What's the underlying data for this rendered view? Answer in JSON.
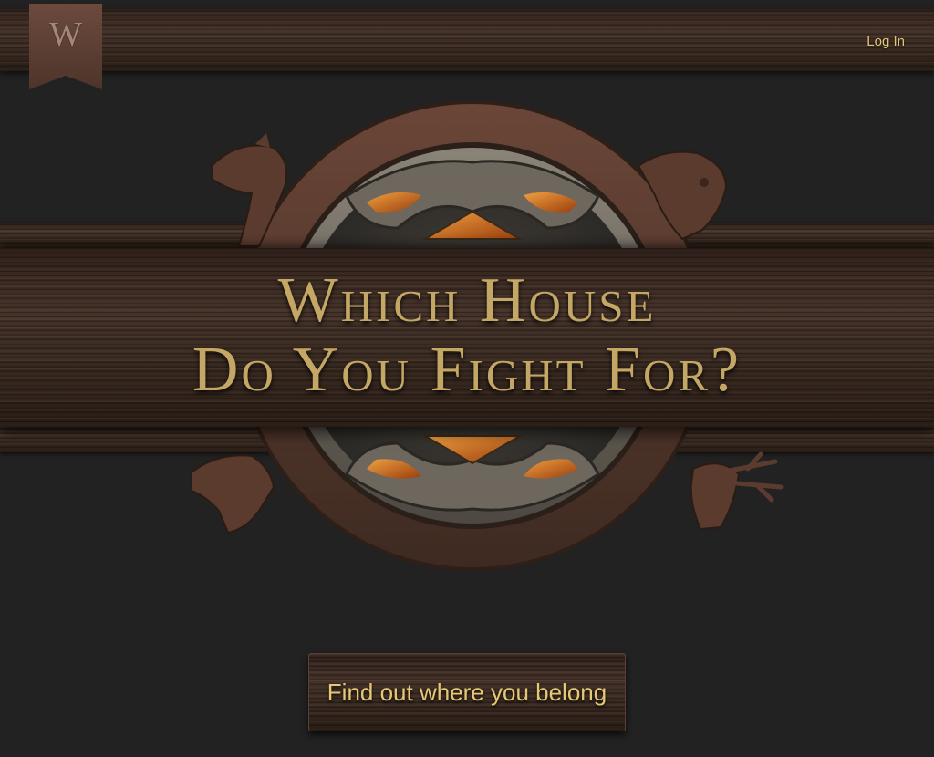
{
  "header": {
    "logo_letter": "W",
    "login_label": "Log In"
  },
  "hero": {
    "headline_line1": "Which House",
    "headline_line2": "Do You Fight For?"
  },
  "cta": {
    "label": "Find out where you belong"
  },
  "colors": {
    "background": "#222222",
    "wood": "#3a2a20",
    "gold_text": "#c5a765",
    "link_gold": "#e2c579",
    "banner_ribbon": "#5a3d32",
    "ember": "#c8641c"
  },
  "icons": [
    "dragon-sigil-icon",
    "lion-sigil-icon",
    "wolf-sigil-icon",
    "stag-sigil-icon"
  ]
}
